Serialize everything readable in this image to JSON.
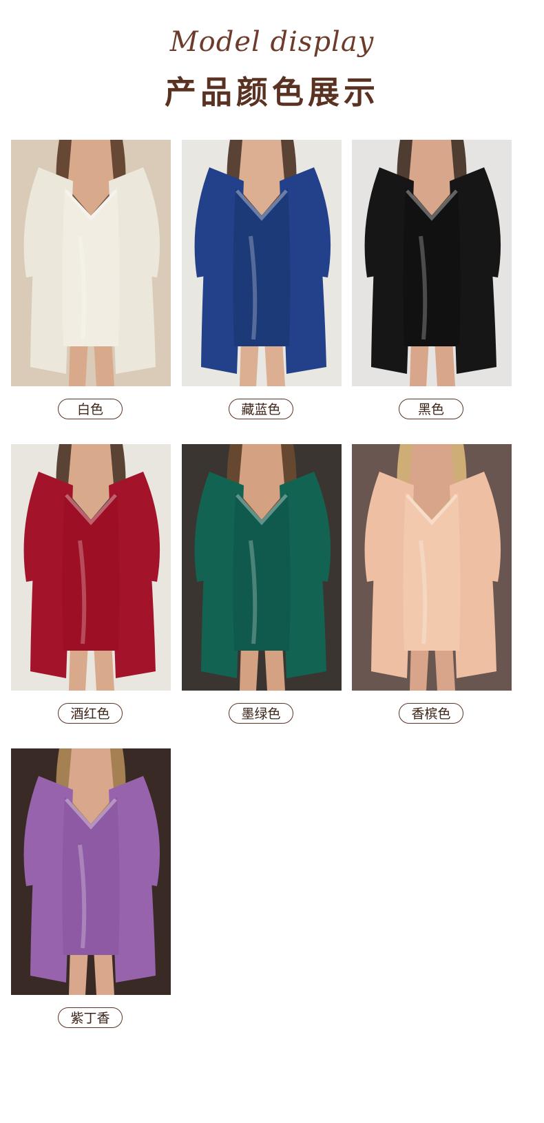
{
  "header": {
    "script_title": "Model display",
    "cn_title": "产品颜色展示"
  },
  "colors": [
    {
      "label": "白色",
      "bg": "#d9cbb8",
      "dress": "#f1ede2",
      "robe": "#ece7db",
      "skin": "#d9a98c",
      "hair": "#5a3a26"
    },
    {
      "label": "藏蓝色",
      "bg": "#e9e7e2",
      "dress": "#1d3a78",
      "robe": "#22418a",
      "skin": "#dcae92",
      "hair": "#4a3022"
    },
    {
      "label": "黑色",
      "bg": "#e6e4e2",
      "dress": "#111111",
      "robe": "#161616",
      "skin": "#d8a68a",
      "hair": "#3e2a1e"
    },
    {
      "label": "酒红色",
      "bg": "#e9e5df",
      "dress": "#9c0f24",
      "robe": "#a3142a",
      "skin": "#d9a98c",
      "hair": "#4a3022"
    },
    {
      "label": "墨绿色",
      "bg": "#3a3530",
      "dress": "#0f5a4c",
      "robe": "#136352",
      "skin": "#d4a282",
      "hair": "#6a4a30"
    },
    {
      "label": "香槟色",
      "bg": "#6a5650",
      "dress": "#f2c9ad",
      "robe": "#eebfa3",
      "skin": "#d9a58a",
      "hair": "#d9b77a"
    },
    {
      "label": "紫丁香",
      "bg": "#3a2a26",
      "dress": "#8e5aa3",
      "robe": "#9763ad",
      "skin": "#d9a88c",
      "hair": "#b08a58"
    }
  ]
}
